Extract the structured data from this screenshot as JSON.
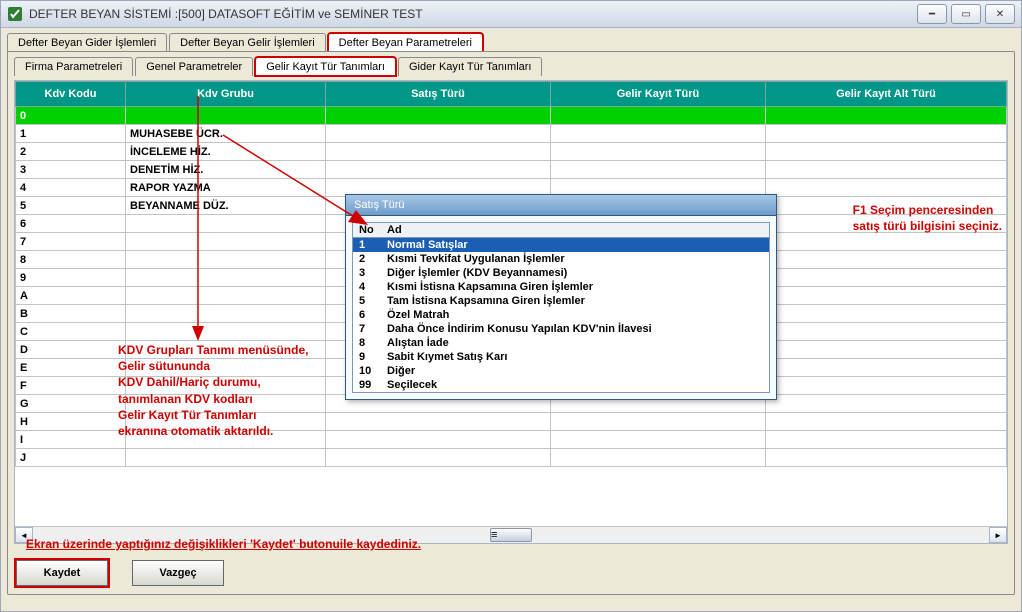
{
  "window": {
    "title": "DEFTER BEYAN SİSTEMİ :[500]  DATASOFT EĞİTİM ve SEMİNER TEST"
  },
  "tabs_top": [
    {
      "label": "Defter Beyan Gider İşlemleri"
    },
    {
      "label": "Defter Beyan Gelir İşlemleri"
    },
    {
      "label": "Defter Beyan Parametreleri"
    }
  ],
  "tabs_sub": [
    {
      "label": "Firma Parametreleri"
    },
    {
      "label": "Genel Parametreler"
    },
    {
      "label": "Gelir Kayıt Tür Tanımları"
    },
    {
      "label": "Gider Kayıt Tür Tanımları"
    }
  ],
  "grid": {
    "headers": [
      "Kdv Kodu",
      "Kdv Grubu",
      "Satış Türü",
      "Gelir Kayıt Türü",
      "Gelir Kayıt Alt Türü"
    ],
    "rows": [
      {
        "c0": "0",
        "c1": "",
        "c2": "",
        "c3": "",
        "c4": "",
        "sel": true
      },
      {
        "c0": "1",
        "c1": "MUHASEBE ÜCR.",
        "c2": "",
        "c3": "",
        "c4": ""
      },
      {
        "c0": "2",
        "c1": "İNCELEME HİZ.",
        "c2": "",
        "c3": "",
        "c4": ""
      },
      {
        "c0": "3",
        "c1": "DENETİM HİZ.",
        "c2": "",
        "c3": "",
        "c4": ""
      },
      {
        "c0": "4",
        "c1": "RAPOR YAZMA",
        "c2": "",
        "c3": "",
        "c4": ""
      },
      {
        "c0": "5",
        "c1": "BEYANNAME DÜZ.",
        "c2": "",
        "c3": "",
        "c4": ""
      },
      {
        "c0": "6",
        "c1": "",
        "c2": "",
        "c3": "",
        "c4": ""
      },
      {
        "c0": "7",
        "c1": "",
        "c2": "",
        "c3": "",
        "c4": ""
      },
      {
        "c0": "8",
        "c1": "",
        "c2": "",
        "c3": "",
        "c4": ""
      },
      {
        "c0": "9",
        "c1": "",
        "c2": "",
        "c3": "",
        "c4": ""
      },
      {
        "c0": "A",
        "c1": "",
        "c2": "",
        "c3": "",
        "c4": ""
      },
      {
        "c0": "B",
        "c1": "",
        "c2": "",
        "c3": "",
        "c4": ""
      },
      {
        "c0": "C",
        "c1": "",
        "c2": "",
        "c3": "",
        "c4": ""
      },
      {
        "c0": "D",
        "c1": "",
        "c2": "",
        "c3": "",
        "c4": ""
      },
      {
        "c0": "E",
        "c1": "",
        "c2": "",
        "c3": "",
        "c4": ""
      },
      {
        "c0": "F",
        "c1": "",
        "c2": "",
        "c3": "",
        "c4": ""
      },
      {
        "c0": "G",
        "c1": "",
        "c2": "",
        "c3": "",
        "c4": ""
      },
      {
        "c0": "H",
        "c1": "",
        "c2": "",
        "c3": "",
        "c4": ""
      },
      {
        "c0": "I",
        "c1": "",
        "c2": "",
        "c3": "",
        "c4": ""
      },
      {
        "c0": "J",
        "c1": "",
        "c2": "",
        "c3": "",
        "c4": ""
      }
    ]
  },
  "popup": {
    "title": "Satış Türü",
    "th_no": "No",
    "th_ad": "Ad",
    "items": [
      {
        "no": "1",
        "ad": "Normal Satışlar",
        "sel": true
      },
      {
        "no": "2",
        "ad": "Kısmi Tevkifat Uygulanan İşlemler"
      },
      {
        "no": "3",
        "ad": "Diğer İşlemler (KDV Beyannamesi)"
      },
      {
        "no": "4",
        "ad": "Kısmi İstisna Kapsamına Giren İşlemler"
      },
      {
        "no": "5",
        "ad": "Tam İstisna Kapsamına Giren İşlemler"
      },
      {
        "no": "6",
        "ad": "Özel Matrah"
      },
      {
        "no": "7",
        "ad": "Daha Önce İndirim Konusu Yapılan KDV'nin İlavesi"
      },
      {
        "no": "8",
        "ad": "Alıştan İade"
      },
      {
        "no": "9",
        "ad": "Sabit Kıymet Satış Karı"
      },
      {
        "no": "10",
        "ad": "Diğer"
      },
      {
        "no": "99",
        "ad": "Seçilecek"
      }
    ]
  },
  "annotations": {
    "left": "KDV Grupları Tanımı menüsünde,\nGelir sütununda\nKDV Dahil/Hariç durumu,\ntanımlanan KDV kodları\nGelir Kayıt Tür Tanımları\nekranına otomatik aktarıldı.",
    "right": "F1 Seçim penceresinden\nsatış türü bilgisini seçiniz.",
    "bottom": "Ekran üzerinde yaptığınız değişiklikleri 'Kaydet' butonuile kaydediniz."
  },
  "buttons": {
    "save": "Kaydet",
    "cancel": "Vazgeç"
  }
}
